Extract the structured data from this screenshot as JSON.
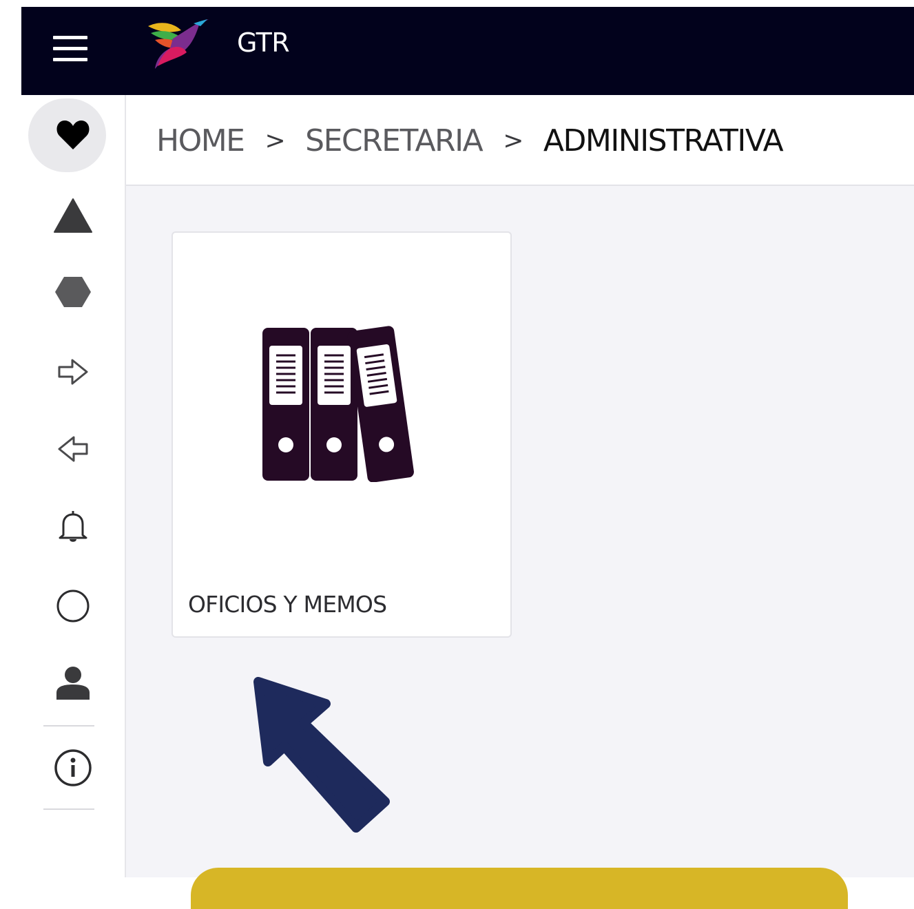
{
  "header": {
    "title": "GTR",
    "menu_icon": "hamburger-menu-icon",
    "logo_icon": "hummingbird-logo"
  },
  "sidebar": {
    "items": [
      {
        "icon": "heart-icon",
        "active": true
      },
      {
        "icon": "triangle-icon"
      },
      {
        "icon": "hexagon-icon"
      },
      {
        "icon": "arrow-right-outline-icon"
      },
      {
        "icon": "arrow-left-outline-icon"
      },
      {
        "icon": "bell-icon"
      },
      {
        "icon": "circle-outline-icon"
      },
      {
        "icon": "user-icon"
      },
      {
        "icon": "info-icon"
      }
    ]
  },
  "breadcrumb": {
    "items": [
      "HOME",
      "SECRETARIA",
      "ADMINISTRATIVA"
    ],
    "separator": ">"
  },
  "cards": [
    {
      "label": "OFICIOS Y MEMOS",
      "icon": "binders-icon"
    }
  ],
  "colors": {
    "topbar": "#02021c",
    "icon_dark": "#250a25",
    "arrow": "#1e2a5c",
    "highlight": "#d7b626"
  }
}
